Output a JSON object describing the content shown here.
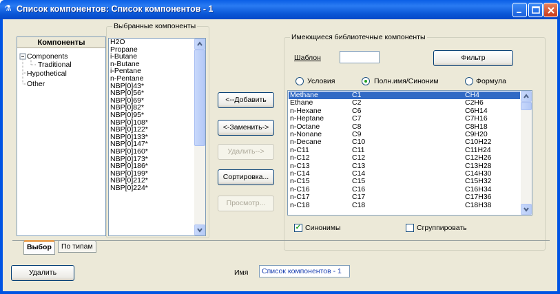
{
  "window": {
    "title": "Список компонентов: Список компонентов - 1"
  },
  "tree": {
    "header": "Компоненты",
    "items": [
      "Components",
      "Traditional",
      "Hypothetical",
      "Other"
    ]
  },
  "selected_group": {
    "title": "Выбранные компоненты",
    "items": [
      "H2O",
      "Propane",
      "i-Butane",
      "n-Butane",
      "i-Pentane",
      "n-Pentane",
      "NBP[0]43*",
      "NBP[0]56*",
      "NBP[0]69*",
      "NBP[0]82*",
      "NBP[0]95*",
      "NBP[0]108*",
      "NBP[0]122*",
      "NBP[0]133*",
      "NBP[0]147*",
      "NBP[0]160*",
      "NBP[0]173*",
      "NBP[0]186*",
      "NBP[0]199*",
      "NBP[0]212*",
      "NBP[0]224*"
    ]
  },
  "buttons": {
    "add": "<--Добавить",
    "replace": "<-Заменить->",
    "remove": "Удалить-->",
    "sort": "Сортировка...",
    "view": "Просмотр...",
    "filter": "Фильтр",
    "delete": "Удалить"
  },
  "library": {
    "title": "Имеющиеся библиотечные компоненты",
    "template_label": "Шаблон",
    "template_value": "",
    "radios": [
      "Условия",
      "Полн.имя/Синоним",
      "Формула"
    ],
    "selected_radio": "Полн.имя/Синоним",
    "rows": [
      [
        "Methane",
        "C1",
        "CH4"
      ],
      [
        "Ethane",
        "C2",
        "C2H6"
      ],
      [
        "n-Hexane",
        "C6",
        "C6H14"
      ],
      [
        "n-Heptane",
        "C7",
        "C7H16"
      ],
      [
        "n-Octane",
        "C8",
        "C8H18"
      ],
      [
        "n-Nonane",
        "C9",
        "C9H20"
      ],
      [
        "n-Decane",
        "C10",
        "C10H22"
      ],
      [
        "n-C11",
        "C11",
        "C11H24"
      ],
      [
        "n-C12",
        "C12",
        "C12H26"
      ],
      [
        "n-C13",
        "C13",
        "C13H28"
      ],
      [
        "n-C14",
        "C14",
        "C14H30"
      ],
      [
        "n-C15",
        "C15",
        "C15H32"
      ],
      [
        "n-C16",
        "C16",
        "C16H34"
      ],
      [
        "n-C17",
        "C17",
        "C17H36"
      ],
      [
        "n-C18",
        "C18",
        "C18H38"
      ]
    ],
    "synonyms_label": "Синонимы",
    "synonyms_checked": true,
    "group_label": "Сгруппировать",
    "group_checked": false
  },
  "tabs": [
    "Выбор",
    "По типам"
  ],
  "active_tab": "Выбор",
  "name": {
    "label": "Имя",
    "value": "Список компонентов - 1"
  },
  "colors": {
    "title_bar": "#0054e3",
    "selection": "#316ac5",
    "name_text": "#1a3fb0"
  }
}
